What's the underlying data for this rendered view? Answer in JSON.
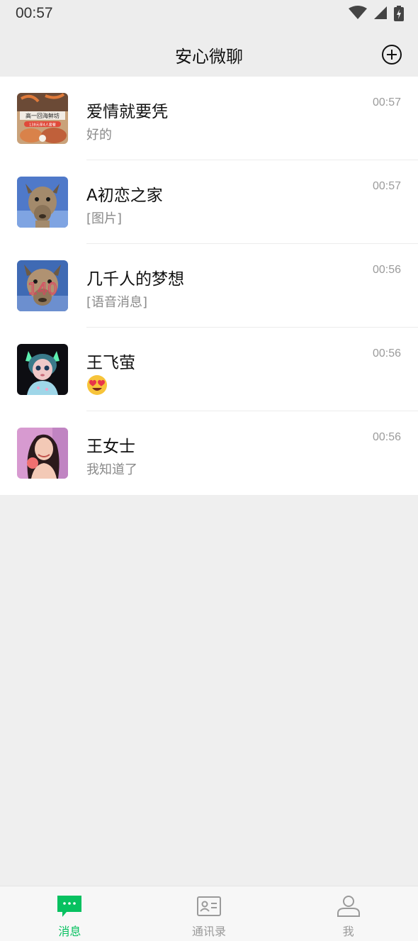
{
  "status_bar": {
    "time": "00:57",
    "icons": [
      "wifi-icon",
      "cellular-signal-icon",
      "battery-charging-icon"
    ]
  },
  "header": {
    "title": "安心微聊",
    "add_icon": "plus-circle-icon"
  },
  "chats": [
    {
      "name": "爱情就要凭",
      "preview": "好的",
      "time": "00:57",
      "avatar": "food-poster"
    },
    {
      "name": "A初恋之家",
      "preview": "[图片]",
      "time": "00:57",
      "avatar": "alpaca"
    },
    {
      "name": "几千人的梦想",
      "preview": "[语音消息]",
      "time": "00:56",
      "avatar": "alpaca-140"
    },
    {
      "name": "王飞萤",
      "preview": "😍",
      "time": "00:56",
      "avatar": "cat-ear-girl"
    },
    {
      "name": "王女士",
      "preview": "我知道了",
      "time": "00:56",
      "avatar": "woman-photo"
    }
  ],
  "avatar_texts": {
    "food_poster_line1": "高一回海鲜坊",
    "food_poster_line2": "138元享4人套餐",
    "alpaca_number": "140"
  },
  "tabs": [
    {
      "label": "消息",
      "icon": "message-bubble-icon",
      "active": true
    },
    {
      "label": "通讯录",
      "icon": "contact-card-icon",
      "active": false
    },
    {
      "label": "我",
      "icon": "person-icon",
      "active": false
    }
  ],
  "colors": {
    "accent": "#07c160",
    "header_bg": "#ededed",
    "page_bg": "#efefef"
  }
}
